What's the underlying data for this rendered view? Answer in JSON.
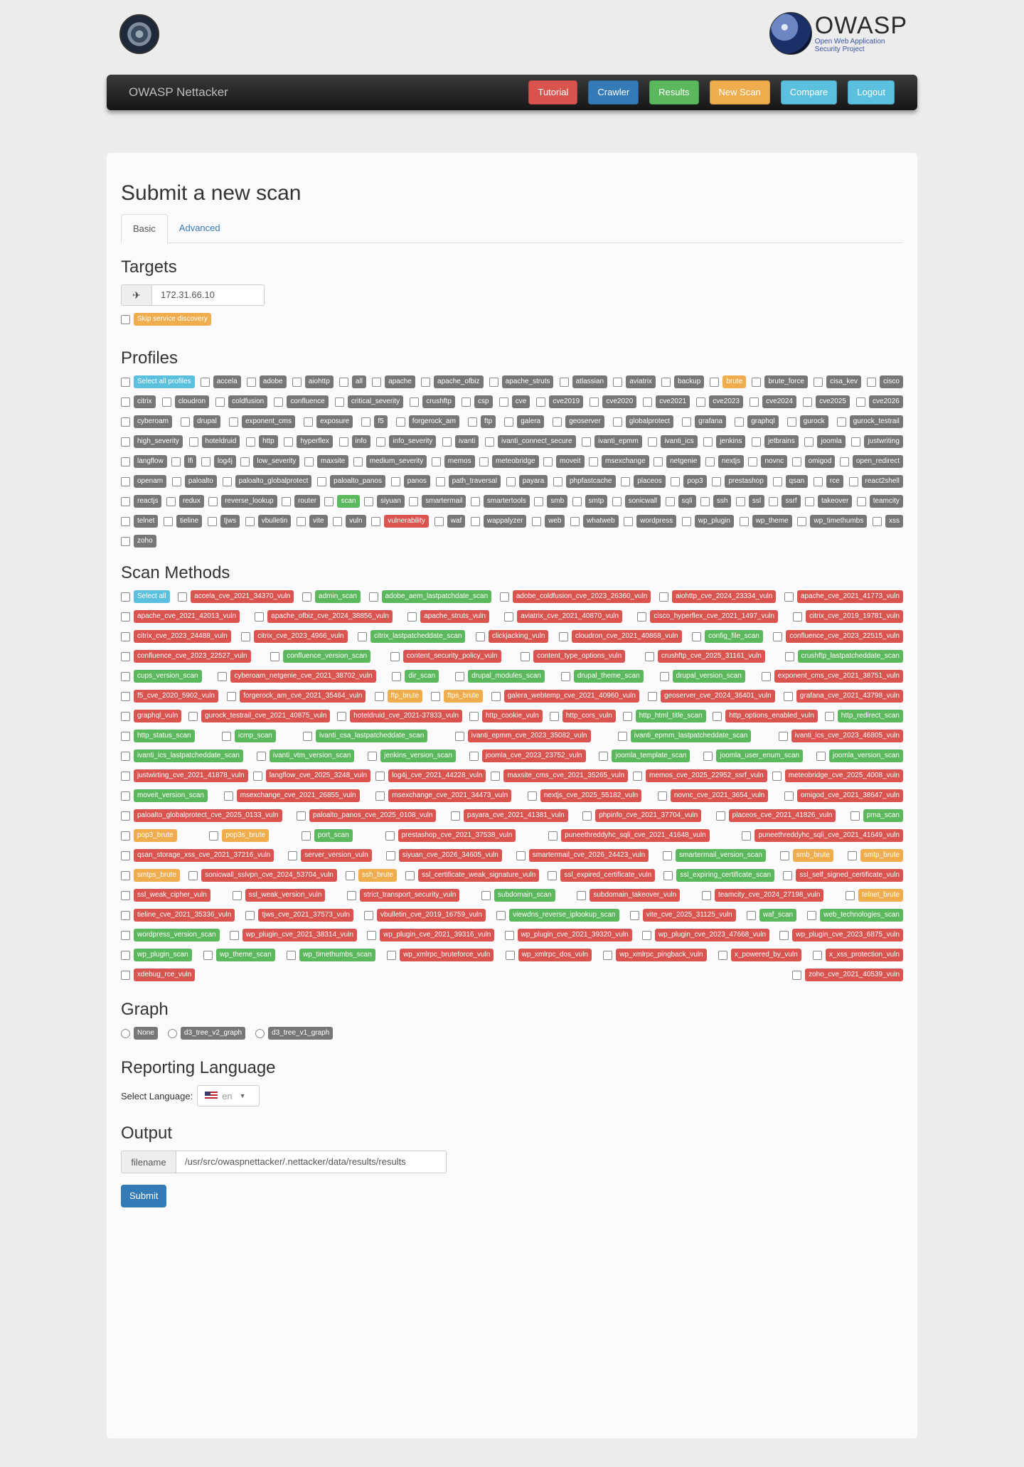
{
  "logo": {
    "word": "OWASP",
    "sub1": "Open Web Application",
    "sub2": "Security Project"
  },
  "navbar": {
    "brand": "OWASP Nettacker",
    "buttons": [
      {
        "label": "Tutorial",
        "color": "red"
      },
      {
        "label": "Crawler",
        "color": "blue"
      },
      {
        "label": "Results",
        "color": "green"
      },
      {
        "label": "New Scan",
        "color": "orange"
      },
      {
        "label": "Compare",
        "color": "info"
      },
      {
        "label": "Logout",
        "color": "info"
      }
    ]
  },
  "page": {
    "title": "Submit a new scan",
    "tabs": [
      "Basic",
      "Advanced"
    ],
    "active_tab": "Basic"
  },
  "targets": {
    "heading": "Targets",
    "value": "172.31.66.10",
    "skip_label": "Skip service discovery"
  },
  "profiles": {
    "heading": "Profiles",
    "items": [
      {
        "l": "Select all profiles",
        "c": "info"
      },
      {
        "l": "accela"
      },
      {
        "l": "adobe"
      },
      {
        "l": "aiohttp"
      },
      {
        "l": "all"
      },
      {
        "l": "apache"
      },
      {
        "l": "apache_ofbiz"
      },
      {
        "l": "apache_struts"
      },
      {
        "l": "atlassian"
      },
      {
        "l": "aviatrix"
      },
      {
        "l": "backup"
      },
      {
        "l": "brute",
        "c": "orange"
      },
      {
        "l": "brute_force"
      },
      {
        "l": "cisa_kev"
      },
      {
        "l": "cisco"
      },
      {
        "l": "citrix"
      },
      {
        "l": "cloudron"
      },
      {
        "l": "coldfusion"
      },
      {
        "l": "confluence"
      },
      {
        "l": "critical_severity"
      },
      {
        "l": "crushftp"
      },
      {
        "l": "csp"
      },
      {
        "l": "cve"
      },
      {
        "l": "cve2019"
      },
      {
        "l": "cve2020"
      },
      {
        "l": "cve2021"
      },
      {
        "l": "cve2023"
      },
      {
        "l": "cve2024"
      },
      {
        "l": "cve2025"
      },
      {
        "l": "cve2026"
      },
      {
        "l": "cyberoam"
      },
      {
        "l": "drupal"
      },
      {
        "l": "exponent_cms"
      },
      {
        "l": "exposure"
      },
      {
        "l": "f5"
      },
      {
        "l": "forgerock_am"
      },
      {
        "l": "ftp"
      },
      {
        "l": "galera"
      },
      {
        "l": "geoserver"
      },
      {
        "l": "globalprotect"
      },
      {
        "l": "grafana"
      },
      {
        "l": "graphql"
      },
      {
        "l": "gurock"
      },
      {
        "l": "gurock_testrail"
      },
      {
        "l": "high_severity"
      },
      {
        "l": "hoteldruid"
      },
      {
        "l": "http"
      },
      {
        "l": "hyperflex"
      },
      {
        "l": "info"
      },
      {
        "l": "info_severity"
      },
      {
        "l": "ivanti"
      },
      {
        "l": "ivanti_connect_secure"
      },
      {
        "l": "ivanti_epmm"
      },
      {
        "l": "ivanti_ics"
      },
      {
        "l": "jenkins"
      },
      {
        "l": "jetbrains"
      },
      {
        "l": "joomla"
      },
      {
        "l": "justwriting"
      },
      {
        "l": "langflow"
      },
      {
        "l": "lfi"
      },
      {
        "l": "log4j"
      },
      {
        "l": "low_severity"
      },
      {
        "l": "maxsite"
      },
      {
        "l": "medium_severity"
      },
      {
        "l": "memos"
      },
      {
        "l": "meteobridge"
      },
      {
        "l": "moveit"
      },
      {
        "l": "msexchange"
      },
      {
        "l": "netgenie"
      },
      {
        "l": "nextjs"
      },
      {
        "l": "novnc"
      },
      {
        "l": "omigod"
      },
      {
        "l": "open_redirect"
      },
      {
        "l": "openam"
      },
      {
        "l": "paloalto"
      },
      {
        "l": "paloalto_globalprotect"
      },
      {
        "l": "paloalto_panos"
      },
      {
        "l": "panos"
      },
      {
        "l": "path_traversal"
      },
      {
        "l": "payara"
      },
      {
        "l": "phpfastcache"
      },
      {
        "l": "placeos"
      },
      {
        "l": "pop3"
      },
      {
        "l": "prestashop"
      },
      {
        "l": "qsan"
      },
      {
        "l": "rce"
      },
      {
        "l": "react2shell"
      },
      {
        "l": "reactjs"
      },
      {
        "l": "redux"
      },
      {
        "l": "reverse_lookup"
      },
      {
        "l": "router"
      },
      {
        "l": "scan",
        "c": "green"
      },
      {
        "l": "siyuan"
      },
      {
        "l": "smartermail"
      },
      {
        "l": "smartertools"
      },
      {
        "l": "smb"
      },
      {
        "l": "smtp"
      },
      {
        "l": "sonicwall"
      },
      {
        "l": "sqli"
      },
      {
        "l": "ssh"
      },
      {
        "l": "ssl"
      },
      {
        "l": "ssrf"
      },
      {
        "l": "takeover"
      },
      {
        "l": "teamcity"
      },
      {
        "l": "telnet"
      },
      {
        "l": "tieline"
      },
      {
        "l": "tjws"
      },
      {
        "l": "vbulletin"
      },
      {
        "l": "vite"
      },
      {
        "l": "vuln"
      },
      {
        "l": "vulnerability",
        "c": "red"
      },
      {
        "l": "waf"
      },
      {
        "l": "wappalyzer"
      },
      {
        "l": "web"
      },
      {
        "l": "whatweb"
      },
      {
        "l": "wordpress"
      },
      {
        "l": "wp_plugin"
      },
      {
        "l": "wp_theme"
      },
      {
        "l": "wp_timethumbs"
      },
      {
        "l": "xss"
      },
      {
        "l": "zoho"
      }
    ]
  },
  "methods": {
    "heading": "Scan Methods",
    "items": [
      {
        "l": "Select all",
        "c": "info"
      },
      {
        "l": "accela_cve_2021_34370_vuln",
        "c": "red"
      },
      {
        "l": "admin_scan",
        "c": "green"
      },
      {
        "l": "adobe_aem_lastpatchdate_scan",
        "c": "green"
      },
      {
        "l": "adobe_coldfusion_cve_2023_26360_vuln",
        "c": "red"
      },
      {
        "l": "aiohttp_cve_2024_23334_vuln",
        "c": "red"
      },
      {
        "l": "apache_cve_2021_41773_vuln",
        "c": "red"
      },
      {
        "l": "apache_cve_2021_42013_vuln",
        "c": "red"
      },
      {
        "l": "apache_ofbiz_cve_2024_38856_vuln",
        "c": "red"
      },
      {
        "l": "apache_struts_vuln",
        "c": "red"
      },
      {
        "l": "aviatrix_cve_2021_40870_vuln",
        "c": "red"
      },
      {
        "l": "cisco_hyperflex_cve_2021_1497_vuln",
        "c": "red"
      },
      {
        "l": "citrix_cve_2019_19781_vuln",
        "c": "red"
      },
      {
        "l": "citrix_cve_2023_24488_vuln",
        "c": "red"
      },
      {
        "l": "citrix_cve_2023_4966_vuln",
        "c": "red"
      },
      {
        "l": "citrix_lastpatcheddate_scan",
        "c": "green"
      },
      {
        "l": "clickjacking_vuln",
        "c": "red"
      },
      {
        "l": "cloudron_cve_2021_40868_vuln",
        "c": "red"
      },
      {
        "l": "config_file_scan",
        "c": "green"
      },
      {
        "l": "confluence_cve_2023_22515_vuln",
        "c": "red"
      },
      {
        "l": "confluence_cve_2023_22527_vuln",
        "c": "red"
      },
      {
        "l": "confluence_version_scan",
        "c": "green"
      },
      {
        "l": "content_security_policy_vuln",
        "c": "red"
      },
      {
        "l": "content_type_options_vuln",
        "c": "red"
      },
      {
        "l": "crushftp_cve_2025_31161_vuln",
        "c": "red"
      },
      {
        "l": "crushftp_lastpatcheddate_scan",
        "c": "green"
      },
      {
        "l": "cups_version_scan",
        "c": "green"
      },
      {
        "l": "cyberoam_netgenie_cve_2021_38702_vuln",
        "c": "red"
      },
      {
        "l": "dir_scan",
        "c": "green"
      },
      {
        "l": "drupal_modules_scan",
        "c": "green"
      },
      {
        "l": "drupal_theme_scan",
        "c": "green"
      },
      {
        "l": "drupal_version_scan",
        "c": "green"
      },
      {
        "l": "exponent_cms_cve_2021_38751_vuln",
        "c": "red"
      },
      {
        "l": "f5_cve_2020_5902_vuln",
        "c": "red"
      },
      {
        "l": "forgerock_am_cve_2021_35464_vuln",
        "c": "red"
      },
      {
        "l": "ftp_brute",
        "c": "orange"
      },
      {
        "l": "ftps_brute",
        "c": "orange"
      },
      {
        "l": "galera_webtemp_cve_2021_40960_vuln",
        "c": "red"
      },
      {
        "l": "geoserver_cve_2024_36401_vuln",
        "c": "red"
      },
      {
        "l": "grafana_cve_2021_43798_vuln",
        "c": "red"
      },
      {
        "l": "graphql_vuln",
        "c": "red"
      },
      {
        "l": "gurock_testrail_cve_2021_40875_vuln",
        "c": "red"
      },
      {
        "l": "hoteldruid_cve_2021-37833_vuln",
        "c": "red"
      },
      {
        "l": "http_cookie_vuln",
        "c": "red"
      },
      {
        "l": "http_cors_vuln",
        "c": "red"
      },
      {
        "l": "http_html_title_scan",
        "c": "green"
      },
      {
        "l": "http_options_enabled_vuln",
        "c": "red"
      },
      {
        "l": "http_redirect_scan",
        "c": "green"
      },
      {
        "l": "http_status_scan",
        "c": "green"
      },
      {
        "l": "icmp_scan",
        "c": "green"
      },
      {
        "l": "ivanti_csa_lastpatcheddate_scan",
        "c": "green"
      },
      {
        "l": "ivanti_epmm_cve_2023_35082_vuln",
        "c": "red"
      },
      {
        "l": "ivanti_epmm_lastpatcheddate_scan",
        "c": "green"
      },
      {
        "l": "ivanti_ics_cve_2023_46805_vuln",
        "c": "red"
      },
      {
        "l": "ivanti_ics_lastpatcheddate_scan",
        "c": "green"
      },
      {
        "l": "ivanti_vtm_version_scan",
        "c": "green"
      },
      {
        "l": "jenkins_version_scan",
        "c": "green"
      },
      {
        "l": "joomla_cve_2023_23752_vuln",
        "c": "red"
      },
      {
        "l": "joomla_template_scan",
        "c": "green"
      },
      {
        "l": "joomla_user_enum_scan",
        "c": "green"
      },
      {
        "l": "joomla_version_scan",
        "c": "green"
      },
      {
        "l": "justwirting_cve_2021_41878_vuln",
        "c": "red"
      },
      {
        "l": "langflow_cve_2025_3248_vuln",
        "c": "red"
      },
      {
        "l": "log4j_cve_2021_44228_vuln",
        "c": "red"
      },
      {
        "l": "maxsite_cms_cve_2021_35265_vuln",
        "c": "red"
      },
      {
        "l": "memos_cve_2025_22952_ssrf_vuln",
        "c": "red"
      },
      {
        "l": "meteobridge_cve_2025_4008_vuln",
        "c": "red"
      },
      {
        "l": "moveit_version_scan",
        "c": "green"
      },
      {
        "l": "msexchange_cve_2021_26855_vuln",
        "c": "red"
      },
      {
        "l": "msexchange_cve_2021_34473_vuln",
        "c": "red"
      },
      {
        "l": "nextjs_cve_2025_55182_vuln",
        "c": "red"
      },
      {
        "l": "novnc_cve_2021_3654_vuln",
        "c": "red"
      },
      {
        "l": "omigod_cve_2021_38647_vuln",
        "c": "red"
      },
      {
        "l": "paloalto_globalprotect_cve_2025_0133_vuln",
        "c": "red"
      },
      {
        "l": "paloalto_panos_cve_2025_0108_vuln",
        "c": "red"
      },
      {
        "l": "payara_cve_2021_41381_vuln",
        "c": "red"
      },
      {
        "l": "phpinfo_cve_2021_37704_vuln",
        "c": "red"
      },
      {
        "l": "placeos_cve_2021_41826_vuln",
        "c": "red"
      },
      {
        "l": "pma_scan",
        "c": "green"
      },
      {
        "l": "pop3_brute",
        "c": "orange"
      },
      {
        "l": "pop3s_brute",
        "c": "orange"
      },
      {
        "l": "port_scan",
        "c": "green"
      },
      {
        "l": "prestashop_cve_2021_37538_vuln",
        "c": "red"
      },
      {
        "l": "puneethreddyhc_sqli_cve_2021_41648_vuln",
        "c": "red"
      },
      {
        "l": "puneethreddyhc_sqli_cve_2021_41649_vuln",
        "c": "red"
      },
      {
        "l": "qsan_storage_xss_cve_2021_37216_vuln",
        "c": "red"
      },
      {
        "l": "server_version_vuln",
        "c": "red"
      },
      {
        "l": "siyuan_cve_2026_34605_vuln",
        "c": "red"
      },
      {
        "l": "smartermail_cve_2026_24423_vuln",
        "c": "red"
      },
      {
        "l": "smartermail_version_scan",
        "c": "green"
      },
      {
        "l": "smb_brute",
        "c": "orange"
      },
      {
        "l": "smtp_brute",
        "c": "orange"
      },
      {
        "l": "smtps_brute",
        "c": "orange"
      },
      {
        "l": "sonicwall_sslvpn_cve_2024_53704_vuln",
        "c": "red"
      },
      {
        "l": "ssh_brute",
        "c": "orange"
      },
      {
        "l": "ssl_certificate_weak_signature_vuln",
        "c": "red"
      },
      {
        "l": "ssl_expired_certificate_vuln",
        "c": "red"
      },
      {
        "l": "ssl_expiring_certificate_scan",
        "c": "green"
      },
      {
        "l": "ssl_self_signed_certificate_vuln",
        "c": "red"
      },
      {
        "l": "ssl_weak_cipher_vuln",
        "c": "red"
      },
      {
        "l": "ssl_weak_version_vuln",
        "c": "red"
      },
      {
        "l": "strict_transport_security_vuln",
        "c": "red"
      },
      {
        "l": "subdomain_scan",
        "c": "green"
      },
      {
        "l": "subdomain_takeover_vuln",
        "c": "red"
      },
      {
        "l": "teamcity_cve_2024_27198_vuln",
        "c": "red"
      },
      {
        "l": "telnet_brute",
        "c": "orange"
      },
      {
        "l": "tieline_cve_2021_35336_vuln",
        "c": "red"
      },
      {
        "l": "tjws_cve_2021_37573_vuln",
        "c": "red"
      },
      {
        "l": "vbulletin_cve_2019_16759_vuln",
        "c": "red"
      },
      {
        "l": "viewdns_reverse_iplookup_scan",
        "c": "green"
      },
      {
        "l": "vite_cve_2025_31125_vuln",
        "c": "red"
      },
      {
        "l": "waf_scan",
        "c": "green"
      },
      {
        "l": "web_technologies_scan",
        "c": "green"
      },
      {
        "l": "wordpress_version_scan",
        "c": "green"
      },
      {
        "l": "wp_plugin_cve_2021_38314_vuln",
        "c": "red"
      },
      {
        "l": "wp_plugin_cve_2021_39316_vuln",
        "c": "red"
      },
      {
        "l": "wp_plugin_cve_2021_39320_vuln",
        "c": "red"
      },
      {
        "l": "wp_plugin_cve_2023_47668_vuln",
        "c": "red"
      },
      {
        "l": "wp_plugin_cve_2023_6875_vuln",
        "c": "red"
      },
      {
        "l": "wp_plugin_scan",
        "c": "green"
      },
      {
        "l": "wp_theme_scan",
        "c": "green"
      },
      {
        "l": "wp_timethumbs_scan",
        "c": "green"
      },
      {
        "l": "wp_xmlrpc_bruteforce_vuln",
        "c": "red"
      },
      {
        "l": "wp_xmlrpc_dos_vuln",
        "c": "red"
      },
      {
        "l": "wp_xmlrpc_pingback_vuln",
        "c": "red"
      },
      {
        "l": "x_powered_by_vuln",
        "c": "red"
      },
      {
        "l": "x_xss_protection_vuln",
        "c": "red"
      },
      {
        "l": "xdebug_rce_vuln",
        "c": "red"
      },
      {
        "l": "zoho_cve_2021_40539_vuln",
        "c": "red"
      }
    ]
  },
  "graph": {
    "heading": "Graph",
    "options": [
      "None",
      "d3_tree_v2_graph",
      "d3_tree_v1_graph"
    ]
  },
  "language": {
    "heading": "Reporting Language",
    "label": "Select Language:",
    "value": "en"
  },
  "output": {
    "heading": "Output",
    "addon": "filename",
    "value": "/usr/src/owaspnettacker/.nettacker/data/results/results"
  },
  "submit_label": "Submit"
}
